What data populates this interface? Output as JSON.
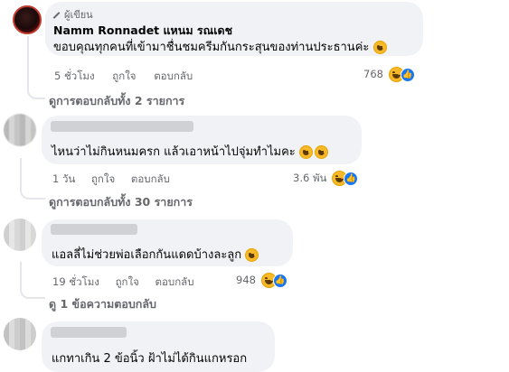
{
  "comments": [
    {
      "badge": "ผู้เขียน",
      "author": "Namm Ronnadet แหนม รณเดช",
      "text": "ขอบคุณทุกคนที่เข้ามาชื่นชมครีมกันกระสุนของท่านประธานค่ะ",
      "time": "5 ชั่วโมง",
      "like_label": "ถูกใจ",
      "reply_label": "ตอบกลับ",
      "reaction_count": "768",
      "view_replies": "ดูการตอบกลับทั้ง 2 รายการ"
    },
    {
      "text": "ไหนว่าไม่กินหนมครก แล้วเอาหน้าไปจุ่มทำไมคะ",
      "time": "1 วัน",
      "like_label": "ถูกใจ",
      "reply_label": "ตอบกลับ",
      "reaction_count": "3.6 พัน",
      "view_replies": "ดูการตอบกลับทั้ง 30 รายการ"
    },
    {
      "text": "แอลลี่ไม่ช่วยพ่อเลือกกันแดดบ้างละลูก",
      "time": "19 ชั่วโมง",
      "like_label": "ถูกใจ",
      "reply_label": "ตอบกลับ",
      "reaction_count": "948",
      "view_replies": "ดู 1 ข้อความตอบกลับ"
    },
    {
      "text": "แกทาเกิน 2 ข้อนิ้ว ฝ้าไม่ได้กินแกหรอก"
    }
  ],
  "icons": {
    "haha": "haha-emoji-icon",
    "like": "like-reaction-icon",
    "author_badge": "pencil-icon",
    "wow": "wow-emoji-icon"
  },
  "colors": {
    "bubble": "#f0f2f5",
    "meta": "#65676b",
    "like_blue": "#1877f2",
    "haha_yellow": "#f7b928"
  }
}
